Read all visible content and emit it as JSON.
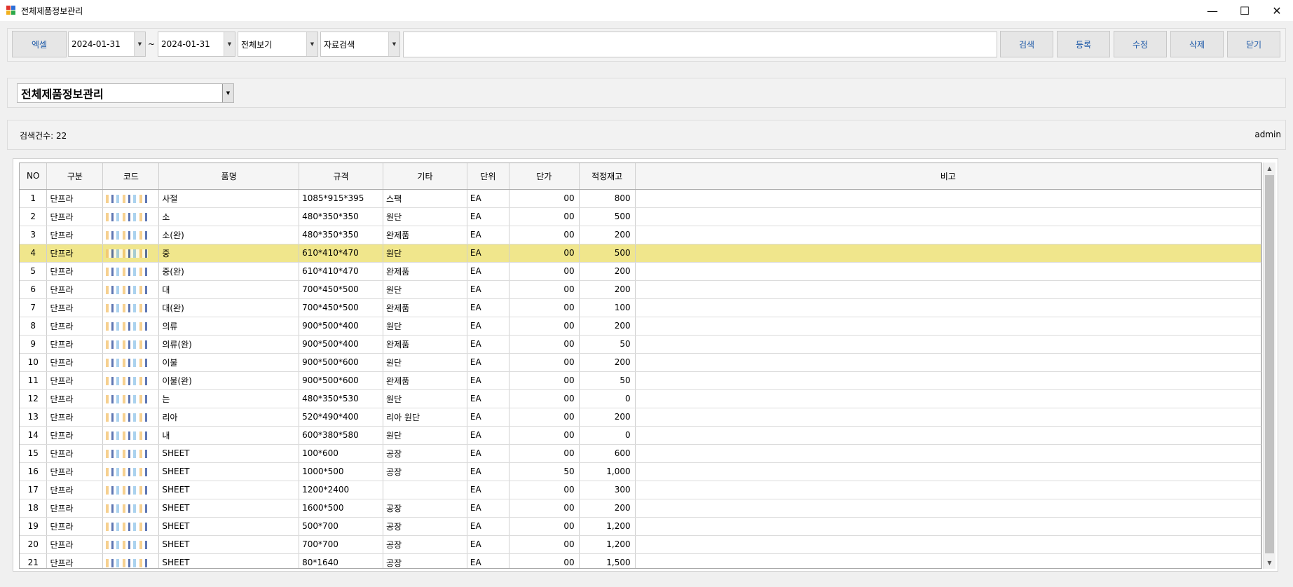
{
  "window": {
    "title": "전체제품정보관리"
  },
  "toolbar": {
    "excel": "엑셀",
    "date_from": "2024-01-31",
    "date_to": "2024-01-31",
    "tilde": "~",
    "view": "전체보기",
    "search_mode": "자료검색",
    "search_value": "",
    "search": "검색",
    "register": "등록",
    "edit": "수정",
    "delete": "삭제",
    "close": "닫기"
  },
  "category": "전체제품정보관리",
  "status": {
    "count": "검색건수: 22",
    "user": "admin"
  },
  "grid": {
    "columns": [
      "NO",
      "구분",
      "코드",
      "품명",
      "규격",
      "기타",
      "단위",
      "단가",
      "적정재고",
      "비고"
    ],
    "rows": [
      {
        "no": "1",
        "type": "단프라",
        "name": "사절",
        "spec": "1085*915*395",
        "etc": "스팩",
        "unit": "EA",
        "price": "00",
        "stock": "800"
      },
      {
        "no": "2",
        "type": "단프라",
        "name": "소",
        "spec": "480*350*350",
        "etc": "원단",
        "unit": "EA",
        "price": "00",
        "stock": "500"
      },
      {
        "no": "3",
        "type": "단프라",
        "name": "소(완)",
        "spec": "480*350*350",
        "etc": "완제품",
        "unit": "EA",
        "price": "00",
        "stock": "200"
      },
      {
        "no": "4",
        "type": "단프라",
        "name": "중",
        "spec": "610*410*470",
        "etc": "원단",
        "unit": "EA",
        "price": "00",
        "stock": "500"
      },
      {
        "no": "5",
        "type": "단프라",
        "name": "중(완)",
        "spec": "610*410*470",
        "etc": "완제품",
        "unit": "EA",
        "price": "00",
        "stock": "200"
      },
      {
        "no": "6",
        "type": "단프라",
        "name": "대",
        "spec": "700*450*500",
        "etc": "원단",
        "unit": "EA",
        "price": "00",
        "stock": "200"
      },
      {
        "no": "7",
        "type": "단프라",
        "name": "대(완)",
        "spec": "700*450*500",
        "etc": "완제품",
        "unit": "EA",
        "price": "00",
        "stock": "100"
      },
      {
        "no": "8",
        "type": "단프라",
        "name": "의류",
        "spec": "900*500*400",
        "etc": "원단",
        "unit": "EA",
        "price": "00",
        "stock": "200"
      },
      {
        "no": "9",
        "type": "단프라",
        "name": "의류(완)",
        "spec": "900*500*400",
        "etc": "완제품",
        "unit": "EA",
        "price": "00",
        "stock": "50"
      },
      {
        "no": "10",
        "type": "단프라",
        "name": "이불",
        "spec": "900*500*600",
        "etc": "원단",
        "unit": "EA",
        "price": "00",
        "stock": "200"
      },
      {
        "no": "11",
        "type": "단프라",
        "name": "이불(완)",
        "spec": "900*500*600",
        "etc": "완제품",
        "unit": "EA",
        "price": "00",
        "stock": "50"
      },
      {
        "no": "12",
        "type": "단프라",
        "name": "는",
        "spec": "480*350*530",
        "etc": "원단",
        "unit": "EA",
        "price": "00",
        "stock": "0"
      },
      {
        "no": "13",
        "type": "단프라",
        "name": "리아",
        "spec": "520*490*400",
        "etc": "리아 원단",
        "unit": "EA",
        "price": "00",
        "stock": "200"
      },
      {
        "no": "14",
        "type": "단프라",
        "name": "내",
        "spec": "600*380*580",
        "etc": "원단",
        "unit": "EA",
        "price": "00",
        "stock": "0"
      },
      {
        "no": "15",
        "type": "단프라",
        "name": "SHEET",
        "spec": "100*600",
        "etc": "공장",
        "unit": "EA",
        "price": "00",
        "stock": "600"
      },
      {
        "no": "16",
        "type": "단프라",
        "name": "SHEET",
        "spec": "1000*500",
        "etc": "공장",
        "unit": "EA",
        "price": "50",
        "stock": "1,000"
      },
      {
        "no": "17",
        "type": "단프라",
        "name": "SHEET",
        "spec": "1200*2400",
        "etc": "",
        "unit": "EA",
        "price": "00",
        "stock": "300"
      },
      {
        "no": "18",
        "type": "단프라",
        "name": "SHEET",
        "spec": "1600*500",
        "etc": "공장",
        "unit": "EA",
        "price": "00",
        "stock": "200"
      },
      {
        "no": "19",
        "type": "단프라",
        "name": "SHEET",
        "spec": "500*700",
        "etc": "공장",
        "unit": "EA",
        "price": "00",
        "stock": "1,200"
      },
      {
        "no": "20",
        "type": "단프라",
        "name": "SHEET",
        "spec": "700*700",
        "etc": "공장",
        "unit": "EA",
        "price": "00",
        "stock": "1,200"
      },
      {
        "no": "21",
        "type": "단프라",
        "name": "SHEET",
        "spec": "80*1640",
        "etc": "공장",
        "unit": "EA",
        "price": "00",
        "stock": "1,500"
      }
    ],
    "selected_row": 4
  },
  "icons": {
    "app": "app-icon",
    "minimize": "minimize-icon",
    "maximize": "maximize-icon",
    "close": "close-icon"
  },
  "colors": {
    "selected_row": "#f0e68c",
    "button_text": "#1e5aa8"
  }
}
